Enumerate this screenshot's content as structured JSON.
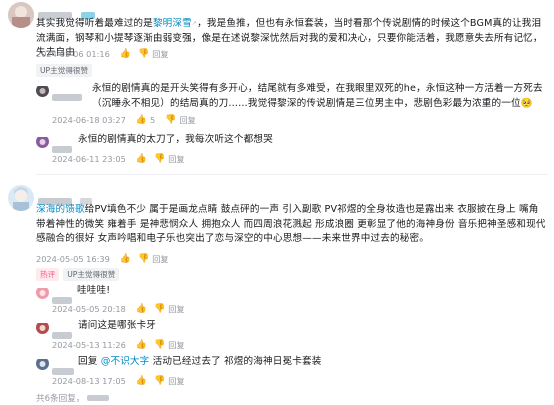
{
  "comment1": {
    "text_part1": "其实我觉得听着最难过的是",
    "link_text": "黎明深雪",
    "text_part2": "，我是鱼推，但也有永恒套装，当时看那个传说剧情的时候这个BGM真的让我泪流满面，钢琴和小提琴逐渐由弱变强，像是在述说黎深忧然后对我的爱和决心，只要你能活着，我愿意失去所有记忆，失去自由",
    "date": "2024-05-06 01:16",
    "likes": "",
    "reply_label": "回复",
    "tag_up": "UP主觉得很赞"
  },
  "reply1": {
    "text": "永恒的剧情真的是开头笑得有多开心，结尾就有多难受，在我眼里双死的he，永恒这种一方活着一方死去（沉睡永不相见）的结局真的刀……我觉得黎深的传说剧情是三位男主中，悲剧色彩最为浓重的一位",
    "emoji": "🥺",
    "date": "2024-06-18 03:27",
    "likes": "5",
    "reply_label": "回复"
  },
  "reply2": {
    "text": "永恒的剧情真的太刀了，我每次听这个都想哭",
    "date": "2024-06-11 23:05",
    "likes": "",
    "reply_label": "回复"
  },
  "comment2": {
    "link_text": "深海的馈歌",
    "text": "给PV填色不少 属于是画龙点睛 鼓点砰的一声 引入副歌 PV祁煜的全身妆造也是露出来 衣服披在身上 嘴角带着神性的微笑 雍着手 是神悲悯众人 拥抱众人 而四周浪花溅起 形成浪圈 更彰显了他的海神身份 音乐把神圣感和现代感融合的很好 女声吟唱和电子乐也突出了恋与深空的中心思想——未来世界中过去的秘密。",
    "date": "2024-05-05 16:39",
    "likes": "",
    "reply_label": "回复",
    "tag_hot": "热评",
    "tag_up": "UP主觉得很赞"
  },
  "reply3": {
    "text": "哇哇哇!",
    "date": "2024-05-05 20:18",
    "likes": "",
    "reply_label": "回复"
  },
  "reply4": {
    "text": "请问这是哪张卡牙",
    "date": "2024-05-13 11:26",
    "likes": "",
    "reply_label": "回复"
  },
  "reply5": {
    "reply_prefix": "回复",
    "at_user": "@不识大字",
    "text": "活动已经过去了 祁煜的海神日冕卡套装",
    "date": "2024-08-13 17:05",
    "likes": "",
    "reply_label": "回复"
  },
  "footer": {
    "fold_text": "共6条回复，"
  }
}
